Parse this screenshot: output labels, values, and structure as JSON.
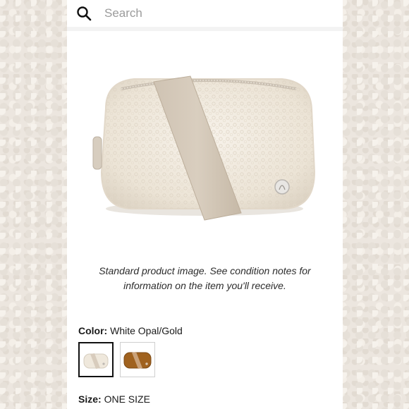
{
  "search": {
    "placeholder": "Search",
    "icon": "search-icon"
  },
  "product": {
    "image_alt": "Fleece belt bag",
    "caption_line1": "Standard product image. See condition notes for",
    "caption_line2": "information on the item you'll receive.",
    "color_label": "Color:",
    "color_value": "White Opal/Gold",
    "swatches": [
      {
        "name": "White Opal/Gold",
        "selected": true,
        "main_color": "#efe8dc",
        "strap_color": "#d8ccbd"
      },
      {
        "name": "Brown",
        "selected": false,
        "main_color": "#a0621f",
        "strap_color": "#caa27a"
      }
    ],
    "size_label": "Size:",
    "size_value": "ONE SIZE"
  },
  "colors": {
    "accent": "#111111",
    "muted_text": "#9b9b9b"
  }
}
